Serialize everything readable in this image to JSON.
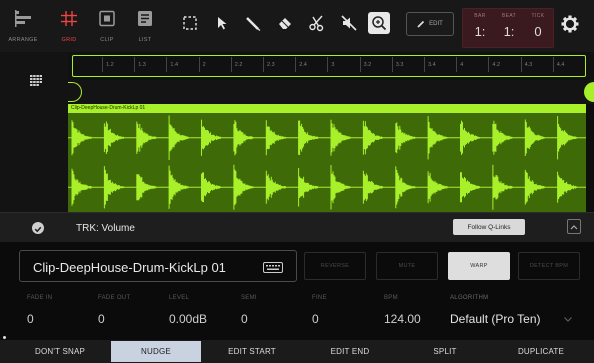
{
  "tabs": [
    {
      "label": "ARRANGE",
      "icon": "arrange-icon",
      "active": false
    },
    {
      "label": "GRID",
      "icon": "grid-icon",
      "active": true
    },
    {
      "label": "CLIP",
      "icon": "clip-icon",
      "active": false
    },
    {
      "label": "LIST",
      "icon": "list-icon",
      "active": false
    }
  ],
  "tools": [
    "marquee-select-icon",
    "pointer-icon",
    "pencil-icon",
    "eraser-icon",
    "scissors-icon",
    "mute-icon",
    "zoom-icon"
  ],
  "edit_button": {
    "label": "EDIT",
    "icon": "pencil-icon"
  },
  "counter": {
    "bar_label": "BAR",
    "bar_value": "1:",
    "beat_label": "BEAT",
    "beat_value": "1:",
    "tick_label": "TICK",
    "tick_value": "0"
  },
  "ruler_ticks": [
    "1.2",
    "1.3",
    "1.4",
    "2",
    "2.2",
    "2.3",
    "2.4",
    "3",
    "3.2",
    "3.3",
    "3.4",
    "4",
    "4.2",
    "4.3",
    "4.4"
  ],
  "clip": {
    "name": "Clip-DeepHouse-Drum-KickLp 01"
  },
  "track": {
    "label": "TRK: Volume",
    "follow_label": "Follow Q-Links"
  },
  "editor": {
    "clip_field": "Clip-DeepHouse-Drum-KickLp 01",
    "buttons": [
      {
        "label": "REVERSE",
        "on": false
      },
      {
        "label": "MUTE",
        "on": false
      },
      {
        "label": "WARP",
        "on": true
      },
      {
        "label": "DETECT BPM",
        "on": false
      }
    ],
    "params": [
      {
        "label": "FADE IN",
        "value": "0"
      },
      {
        "label": "FADE OUT",
        "value": "0"
      },
      {
        "label": "LEVEL",
        "value": "0.00dB"
      },
      {
        "label": "SEMI",
        "value": "0"
      },
      {
        "label": "FINE",
        "value": "0"
      },
      {
        "label": "BPM",
        "value": "124.00"
      }
    ],
    "algorithm_label": "ALGORITHM",
    "algorithm_value": "Default (Pro Ten)"
  },
  "bottom_buttons": [
    {
      "label": "DON'T SNAP",
      "on": false
    },
    {
      "label": "NUDGE",
      "on": true
    },
    {
      "label": "EDIT START",
      "on": false
    },
    {
      "label": "EDIT END",
      "on": false
    },
    {
      "label": "SPLIT",
      "on": false
    },
    {
      "label": "DUPLICATE",
      "on": false
    }
  ],
  "colors": {
    "accent": "#a8f02a",
    "waveform_bg": "#3f6a08",
    "active_tab": "#e44444",
    "counter_bg": "#3a1a1e"
  }
}
